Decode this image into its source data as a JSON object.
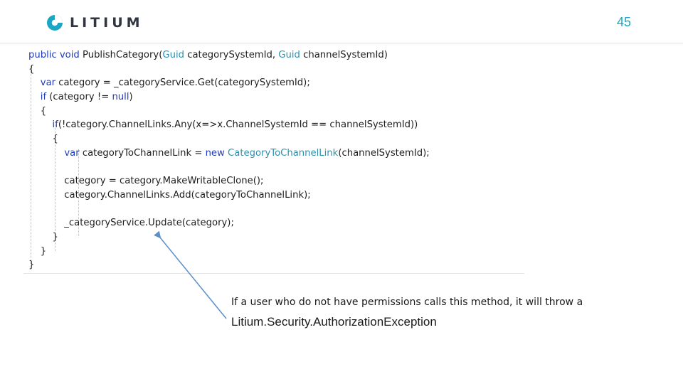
{
  "header": {
    "logo_text": "LITIUM",
    "page_number": "45"
  },
  "code": {
    "lines": [
      [
        {
          "t": "public void ",
          "c": "kw"
        },
        {
          "t": "PublishCategory(",
          "c": ""
        },
        {
          "t": "Guid",
          "c": "type"
        },
        {
          "t": " categorySystemId, ",
          "c": ""
        },
        {
          "t": "Guid",
          "c": "type"
        },
        {
          "t": " channelSystemId)",
          "c": ""
        }
      ],
      [
        {
          "t": "{",
          "c": ""
        }
      ],
      [
        {
          "t": "    ",
          "c": ""
        },
        {
          "t": "var",
          "c": "kw"
        },
        {
          "t": " category = _categoryService.Get(categorySystemId);",
          "c": ""
        }
      ],
      [
        {
          "t": "    ",
          "c": ""
        },
        {
          "t": "if",
          "c": "kw"
        },
        {
          "t": " (category != ",
          "c": ""
        },
        {
          "t": "null",
          "c": "kw"
        },
        {
          "t": ")",
          "c": ""
        }
      ],
      [
        {
          "t": "    {",
          "c": ""
        }
      ],
      [
        {
          "t": "        ",
          "c": ""
        },
        {
          "t": "if",
          "c": "kw"
        },
        {
          "t": "(!category.ChannelLinks.Any(x=>x.ChannelSystemId == channelSystemId))",
          "c": ""
        }
      ],
      [
        {
          "t": "        {",
          "c": ""
        }
      ],
      [
        {
          "t": "            ",
          "c": ""
        },
        {
          "t": "var",
          "c": "kw"
        },
        {
          "t": " categoryToChannelLink = ",
          "c": ""
        },
        {
          "t": "new",
          "c": "kw"
        },
        {
          "t": " ",
          "c": ""
        },
        {
          "t": "CategoryToChannelLink",
          "c": "type"
        },
        {
          "t": "(channelSystemId);",
          "c": ""
        }
      ],
      [
        {
          "t": "",
          "c": ""
        }
      ],
      [
        {
          "t": "            category = category.MakeWritableClone();",
          "c": ""
        }
      ],
      [
        {
          "t": "            category.ChannelLinks.Add(categoryToChannelLink);",
          "c": ""
        }
      ],
      [
        {
          "t": "",
          "c": ""
        }
      ],
      [
        {
          "t": "            _categoryService.Update(category);",
          "c": ""
        }
      ],
      [
        {
          "t": "        }",
          "c": ""
        }
      ],
      [
        {
          "t": "    }",
          "c": ""
        }
      ],
      [
        {
          "t": "}",
          "c": ""
        }
      ]
    ]
  },
  "caption": {
    "text": "If a user who do not have permissions calls this method, it will throw a",
    "exception": "Litium.Security.AuthorizationException"
  },
  "colors": {
    "accent": "#1ba7c4",
    "keyword": "#1f3cbf",
    "type": "#2b91af",
    "arrow": "#5b8fc7"
  }
}
